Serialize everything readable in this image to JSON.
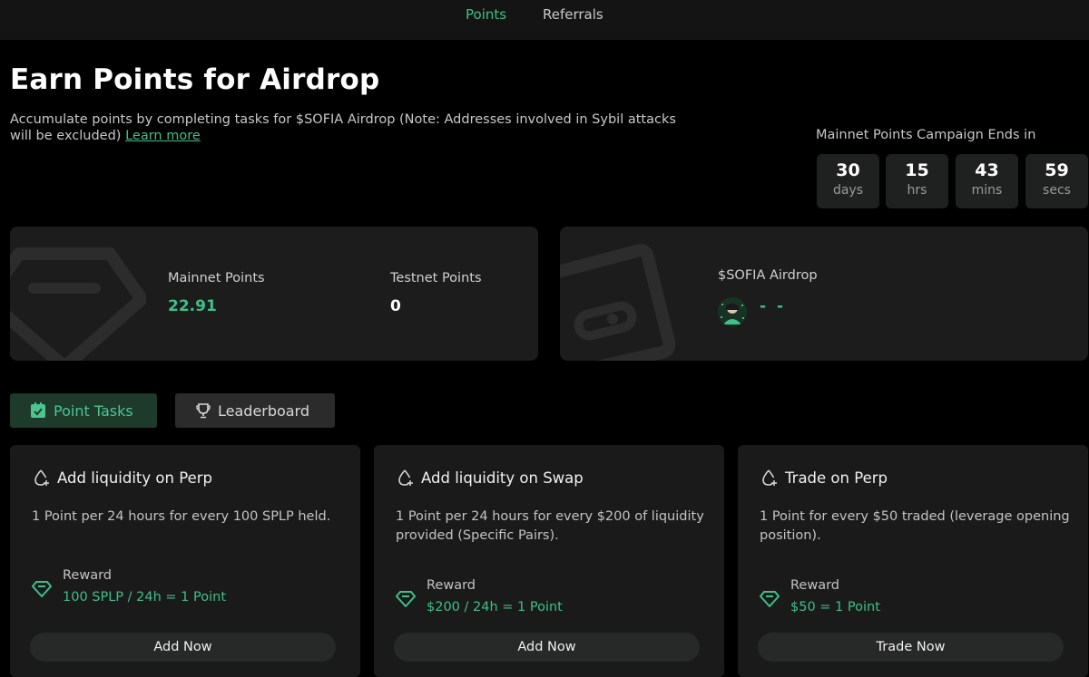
{
  "nav": {
    "tabs": [
      {
        "label": "Points",
        "active": true
      },
      {
        "label": "Referrals",
        "active": false
      }
    ]
  },
  "header": {
    "title": "Earn Points for Airdrop",
    "description": "Accumulate points by completing tasks for $SOFIA Airdrop (Note: Addresses involved in Sybil attacks will be excluded)",
    "learn_more": "Learn more"
  },
  "countdown": {
    "label": "Mainnet Points Campaign Ends in",
    "units": [
      {
        "value": "30",
        "unit": "days"
      },
      {
        "value": "15",
        "unit": "hrs"
      },
      {
        "value": "43",
        "unit": "mins"
      },
      {
        "value": "59",
        "unit": "secs"
      }
    ]
  },
  "points_panel": {
    "mainnet_label": "Mainnet Points",
    "mainnet_value": "22.91",
    "testnet_label": "Testnet Points",
    "testnet_value": "0"
  },
  "airdrop_panel": {
    "label": "$SOFIA Airdrop",
    "value": "- -"
  },
  "tabs": {
    "point_tasks": "Point Tasks",
    "leaderboard": "Leaderboard"
  },
  "tasks": [
    {
      "title": "Add liquidity on Perp",
      "description": "1 Point per 24 hours for every 100 SPLP held.",
      "reward_label": "Reward",
      "reward_value": "100 SPLP / 24h = 1 Point",
      "action": "Add Now"
    },
    {
      "title": "Add liquidity on Swap",
      "description": "1 Point per 24 hours for every $200 of liquidity provided (Specific Pairs).",
      "reward_label": "Reward",
      "reward_value": "$200 / 24h = 1 Point",
      "action": "Add Now"
    },
    {
      "title": "Trade on Perp",
      "description": "1 Point for every $50 traded (leverage opening position).",
      "reward_label": "Reward",
      "reward_value": "$50 = 1 Point",
      "action": "Trade Now"
    }
  ],
  "colors": {
    "accent": "#3fbf8a",
    "background": "#000000",
    "panel": "#1c1c1c",
    "card": "#1a1a1a"
  },
  "icons": [
    "gem-icon",
    "wallet-icon",
    "checklist-icon",
    "trophy-icon",
    "droplet-icon",
    "avatar-icon"
  ]
}
